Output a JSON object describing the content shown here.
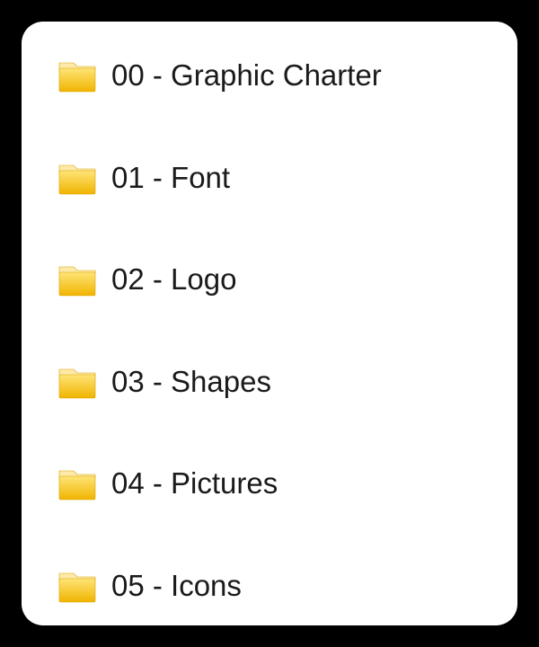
{
  "folders": [
    {
      "label": "00 - Graphic Charter"
    },
    {
      "label": "01 - Font"
    },
    {
      "label": "02 - Logo"
    },
    {
      "label": "03 - Shapes"
    },
    {
      "label": "04 - Pictures"
    },
    {
      "label": "05 - Icons"
    }
  ],
  "colors": {
    "folder_top": "#fff3b3",
    "folder_main_light": "#ffe477",
    "folder_main_dark": "#f0b400",
    "folder_stroke": "#d9a400"
  }
}
